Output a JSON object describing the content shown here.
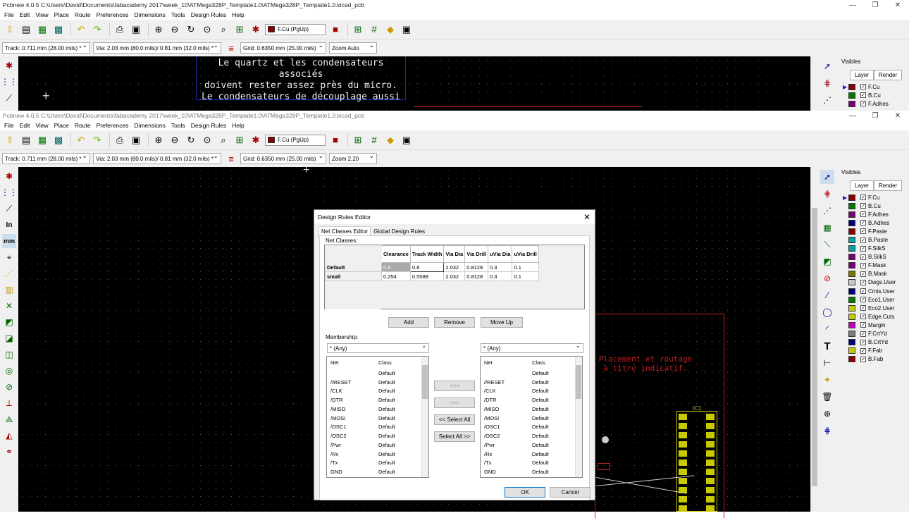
{
  "back_window": {
    "title": "Pcbnew 4.0.5 C:\\Users\\David\\Documents\\fabacademy 2017\\week_10\\ATMega328P_Template1.0\\ATMega328P_Template1.0.kicad_pcb",
    "menus": [
      "File",
      "Edit",
      "View",
      "Place",
      "Route",
      "Preferences",
      "Dimensions",
      "Tools",
      "Design Rules",
      "Help"
    ],
    "layer_select": "F.Cu (PgUp)",
    "track": "Track: 0.711 mm (28.00 mils) *",
    "via": "Via: 2.03 mm (80.0 mils)/ 0.81 mm (32.0 mils) *",
    "grid": "Grid: 0.6350 mm (25.00 mils)",
    "zoom": "Zoom Auto",
    "canvas_text": [
      "Le quartz et les condensateurs associés",
      "doivent rester assez près du micro.",
      "Le condensateurs de découplage aussi"
    ],
    "visibles_title": "Visibles",
    "tabs": [
      "Layer",
      "Render"
    ],
    "layers": [
      "F.Cu",
      "B.Cu",
      "F.Adhes"
    ]
  },
  "front_window": {
    "title": "Pcbnew 4.0.5 C:\\Users\\David\\Documents\\fabacademy 2017\\week_10\\ATMega328P_Template1.0\\ATMega328P_Template1.0.kicad_pcb",
    "menus": [
      "File",
      "Edit",
      "View",
      "Place",
      "Route",
      "Preferences",
      "Dimensions",
      "Tools",
      "Design Rules",
      "Help"
    ],
    "layer_select": "F.Cu (PgUp)",
    "track": "Track: 0.711 mm (28.00 mils) *",
    "via": "Via: 2.03 mm (80.0 mils)/ 0.81 mm (32.0 mils) *",
    "grid": "Grid: 0.6350 mm (25.00 mils)",
    "zoom": "Zoom 2.20",
    "canvas_text": [
      "Placement et routage",
      "à titre indicatif."
    ],
    "component_ref": "IC1",
    "visibles_title": "Visibles",
    "tabs": [
      "Layer",
      "Render"
    ],
    "layers": [
      {
        "name": "F.Cu",
        "color": "#8b0000"
      },
      {
        "name": "B.Cu",
        "color": "#007a00"
      },
      {
        "name": "F.Adhes",
        "color": "#7a007a"
      },
      {
        "name": "B.Adhes",
        "color": "#00007a"
      },
      {
        "name": "F.Paste",
        "color": "#8b0000"
      },
      {
        "name": "B.Paste",
        "color": "#00a0a0"
      },
      {
        "name": "F.SilkS",
        "color": "#00a0a0"
      },
      {
        "name": "B.SilkS",
        "color": "#7a007a"
      },
      {
        "name": "F.Mask",
        "color": "#7a007a"
      },
      {
        "name": "B.Mask",
        "color": "#7a7a00"
      },
      {
        "name": "Dwgs.User",
        "color": "#c8c8c8"
      },
      {
        "name": "Cmts.User",
        "color": "#00007a"
      },
      {
        "name": "Eco1.User",
        "color": "#007a00"
      },
      {
        "name": "Eco2.User",
        "color": "#c8c800"
      },
      {
        "name": "Edge.Cuts",
        "color": "#c8c800"
      },
      {
        "name": "Margin",
        "color": "#c800c8"
      },
      {
        "name": "F.CrtYd",
        "color": "#7a7a7a"
      },
      {
        "name": "B.CrtYd",
        "color": "#00007a"
      },
      {
        "name": "F.Fab",
        "color": "#c8c800"
      },
      {
        "name": "B.Fab",
        "color": "#8b0000"
      }
    ]
  },
  "dialog": {
    "title": "Design Rules Editor",
    "tabs": [
      "Net Classes Editor",
      "Global Design Rules"
    ],
    "net_classes_label": "Net Classes:",
    "columns": [
      "Clearance",
      "Track Width",
      "Via Dia",
      "Via Drill",
      "uVia Dia",
      "uVia Drill"
    ],
    "rows": [
      {
        "name": "Default",
        "values": [
          "0.8",
          "0.8",
          "2.032",
          "0.8128",
          "0.3",
          "0.1"
        ]
      },
      {
        "name": "small",
        "values": [
          "0.254",
          "0.5588",
          "2.032",
          "0.8128",
          "0.3",
          "0.1"
        ]
      }
    ],
    "buttons": {
      "add": "Add",
      "remove": "Remove",
      "move_up": "Move Up",
      "move_left": "<<<",
      "move_right": ">>>",
      "select_all_left": "<< Select All",
      "select_all_right": "Select All >>",
      "ok": "OK",
      "cancel": "Cancel"
    },
    "membership_label": "Membership:",
    "filter_left": "* (Any)",
    "filter_right": "* (Any)",
    "list_headers": {
      "net": "Net",
      "class": "Class"
    },
    "left_list": [
      {
        "net": "",
        "class": "Default"
      },
      {
        "net": "//RESET",
        "class": "Default"
      },
      {
        "net": "/CLK",
        "class": "Default"
      },
      {
        "net": "/DTR",
        "class": "Default"
      },
      {
        "net": "/MISO",
        "class": "Default"
      },
      {
        "net": "/MOSI",
        "class": "Default"
      },
      {
        "net": "/OSC1",
        "class": "Default"
      },
      {
        "net": "/OSC2",
        "class": "Default"
      },
      {
        "net": "/Pwr",
        "class": "Default"
      },
      {
        "net": "/Rx",
        "class": "Default"
      },
      {
        "net": "/Tx",
        "class": "Default"
      },
      {
        "net": "GND",
        "class": "Default"
      }
    ],
    "right_list": [
      {
        "net": "",
        "class": "Default"
      },
      {
        "net": "//RESET",
        "class": "Default"
      },
      {
        "net": "/CLK",
        "class": "Default"
      },
      {
        "net": "/DTR",
        "class": "Default"
      },
      {
        "net": "/MISO",
        "class": "Default"
      },
      {
        "net": "/MOSI",
        "class": "Default"
      },
      {
        "net": "/OSC1",
        "class": "Default"
      },
      {
        "net": "/OSC2",
        "class": "Default"
      },
      {
        "net": "/Pwr",
        "class": "Default"
      },
      {
        "net": "/Rx",
        "class": "Default"
      },
      {
        "net": "/Tx",
        "class": "Default"
      },
      {
        "net": "GND",
        "class": "Default"
      }
    ]
  }
}
